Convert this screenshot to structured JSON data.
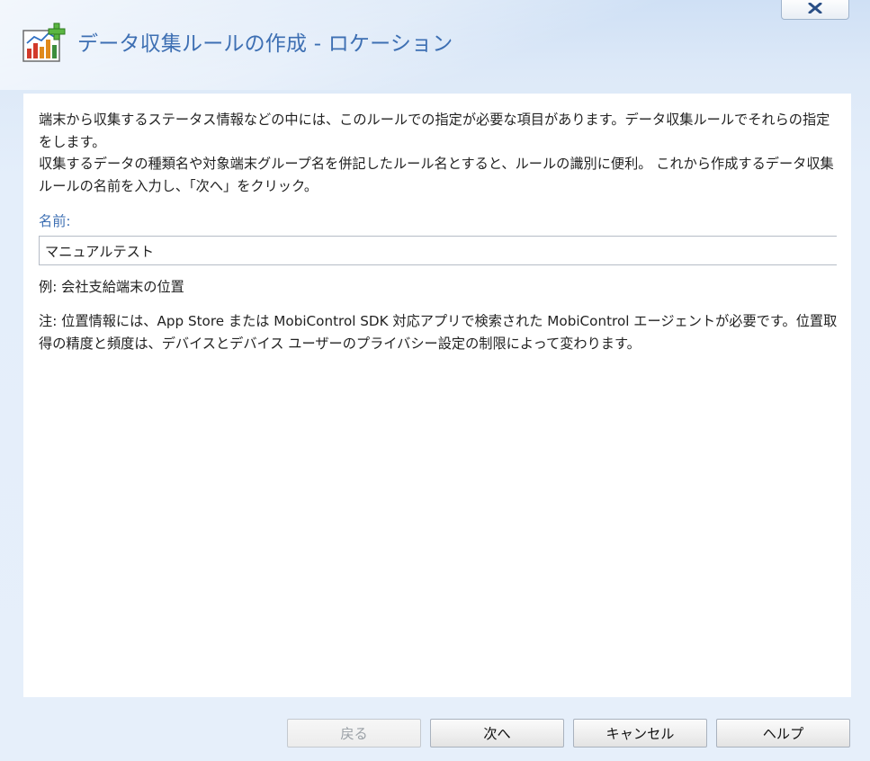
{
  "window": {
    "title": "データ収集ルールの作成 - ロケーション",
    "close_label": "×",
    "accent_color": "#3d6fb3"
  },
  "content": {
    "description_lines": [
      "端末から収集するステータス情報などの中には、このルールでの指定が必要な項目があります。データ収集ルールでそれらの指定をします。",
      "収集するデータの種類名や対象端末グループ名を併記したルール名とすると、ルールの識別に便利。 これから作成するデータ収集ルールの名前を入力し、「次へ」をクリック。"
    ],
    "name_label": "名前:",
    "name_value": "マニュアルテスト",
    "example": "例: 会社支給端末の位置",
    "note": "注: 位置情報には、App Store または MobiControl SDK 対応アプリで検索された MobiControl エージェントが必要です。位置取得の精度と頻度は、デバイスとデバイス ユーザーのプライバシー設定の制限によって変わります。"
  },
  "buttons": {
    "back": "戻る",
    "next": "次へ",
    "cancel": "キャンセル",
    "help": "ヘルプ"
  },
  "icons": {
    "title_icon": "chart-add-icon",
    "close_icon": "close-icon"
  }
}
